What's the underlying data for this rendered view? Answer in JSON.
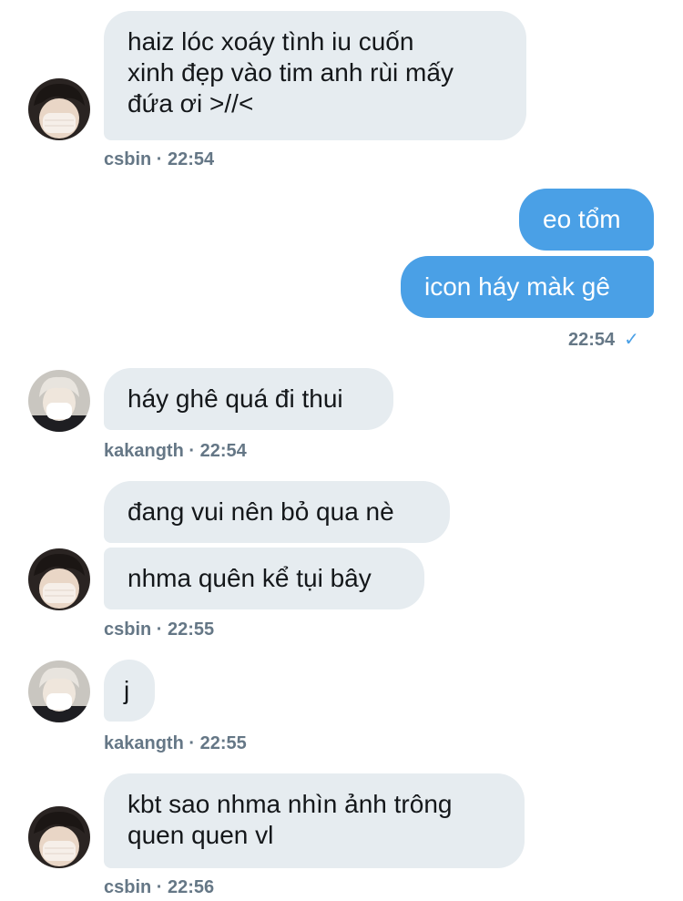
{
  "messages": [
    {
      "sender": "csbin",
      "text": "haiz lóc xoáy tình iu cuốn\nxinh đẹp vào tim anh rùi mấy\nđứa ơi >//<"
    },
    {
      "sender": "me",
      "text": "eo tổm"
    },
    {
      "sender": "me",
      "text": "icon háy màk gê"
    },
    {
      "sender": "kakangth",
      "text": "háy ghê quá đi thui"
    },
    {
      "sender": "csbin",
      "text": "đang vui nên bỏ qua nè"
    },
    {
      "sender": "csbin",
      "text": "nhma quên kể tụi bây"
    },
    {
      "sender": "kakangth",
      "text": "j"
    },
    {
      "sender": "csbin",
      "text": "kbt sao nhma nhìn ảnh trông\nquen quen vl"
    }
  ],
  "meta": [
    {
      "text": "csbin · 22:54"
    },
    {
      "text": "22:54"
    },
    {
      "text": "kakangth · 22:54"
    },
    {
      "text": "csbin · 22:55"
    },
    {
      "text": "kakangth · 22:55"
    },
    {
      "text": "csbin · 22:56"
    }
  ],
  "icons": {
    "read_receipt": "check-icon",
    "avatar_csbin": "avatar-masked-dark-hair",
    "avatar_kakangth": "avatar-masked-light-hair"
  },
  "colors": {
    "sent_bubble": "#4aa0e6",
    "received_bubble": "#e6ecf0",
    "meta_text": "#657786",
    "check": "#4aa0e6"
  }
}
